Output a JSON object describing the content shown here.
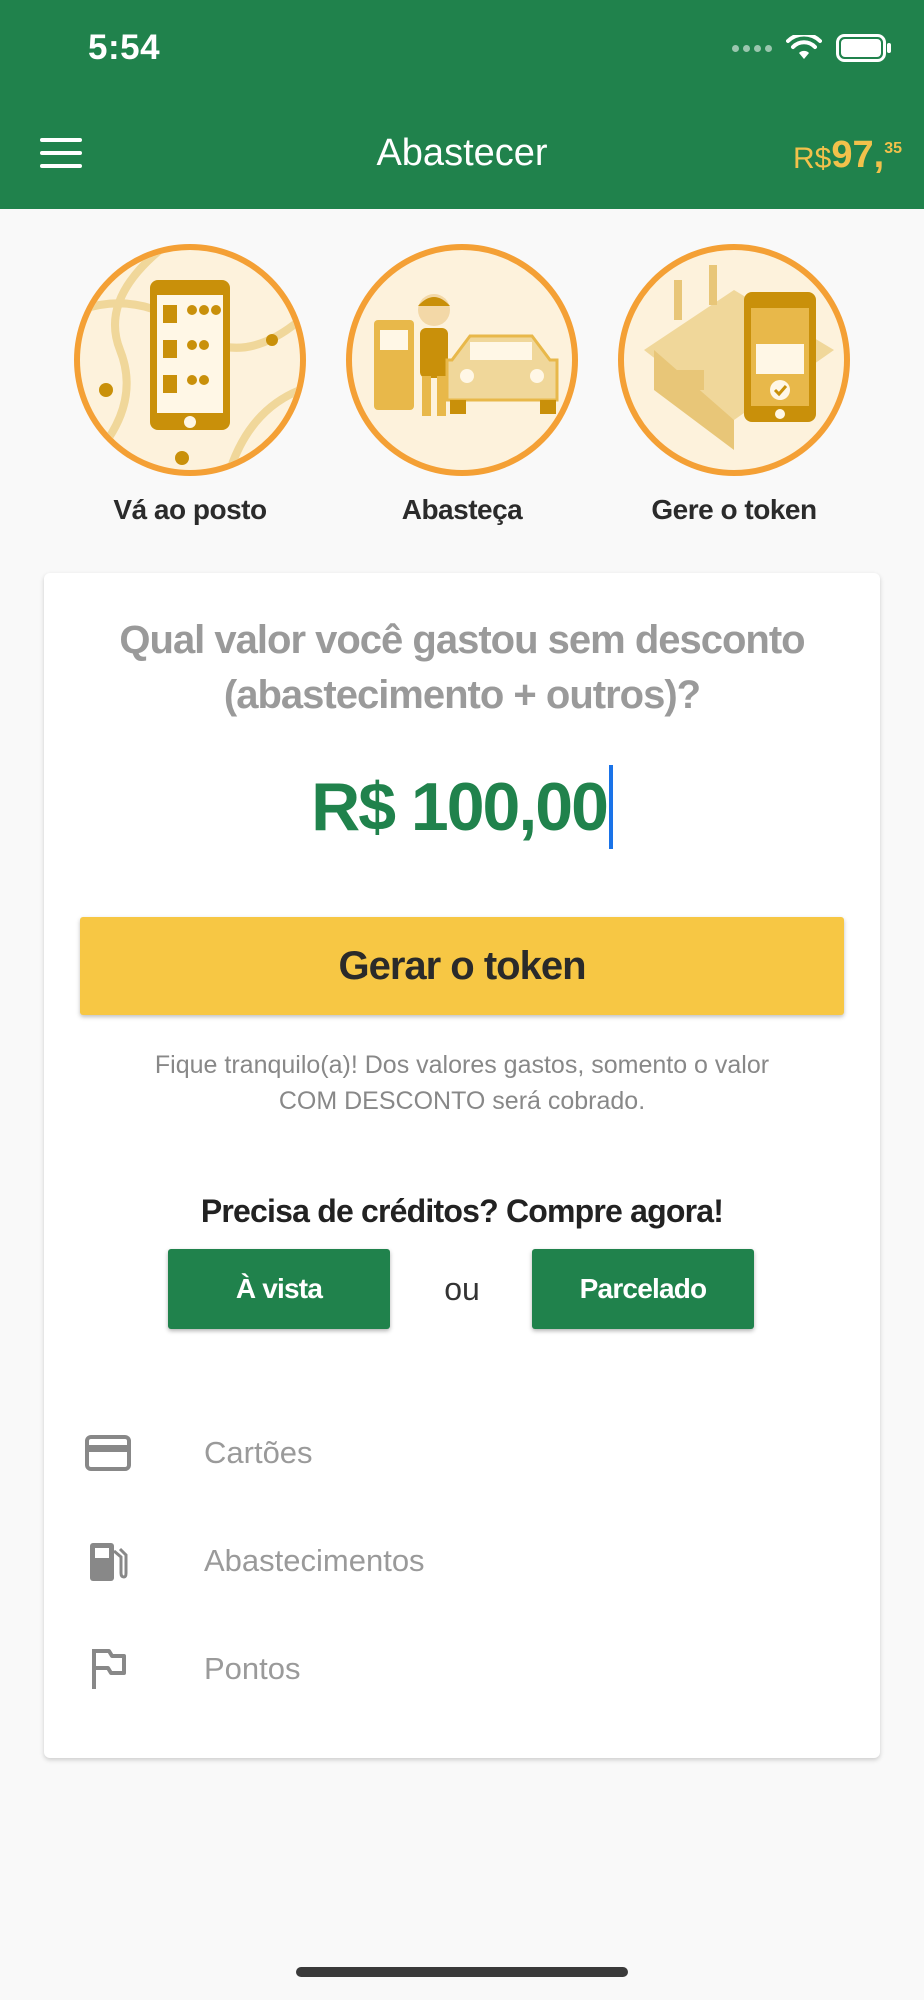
{
  "status_bar": {
    "time": "5:54"
  },
  "header": {
    "title": "Abastecer",
    "balance_currency": "R$",
    "balance_int": "97,",
    "balance_cents": "35"
  },
  "steps": [
    {
      "label": "Vá ao posto",
      "icon": "phone-map-icon"
    },
    {
      "label": "Abasteça",
      "icon": "attendant-car-icon"
    },
    {
      "label": "Gere o token",
      "icon": "token-phone-icon"
    }
  ],
  "card": {
    "question_line1": "Qual valor você gastou sem desconto",
    "question_line2": "(abastecimento + outros)?",
    "amount": "R$ 100,00",
    "generate_label": "Gerar o token",
    "note_line1": "Fique tranquilo(a)! Dos valores gastos, somento o valor",
    "note_line2": "COM DESCONTO será cobrado.",
    "credits_title": "Precisa de créditos? Compre agora!",
    "buy_cash_label": "À vista",
    "or_label": "ou",
    "buy_installments_label": "Parcelado",
    "menu": [
      {
        "label": "Cartões",
        "icon": "credit-card-icon"
      },
      {
        "label": "Abastecimentos",
        "icon": "fuel-pump-icon"
      },
      {
        "label": "Pontos",
        "icon": "flag-icon"
      }
    ]
  },
  "colors": {
    "primary_green": "#20824c",
    "accent_yellow": "#f7c744",
    "ring_orange": "#f4a035",
    "balance_gold": "#f2c14b"
  }
}
